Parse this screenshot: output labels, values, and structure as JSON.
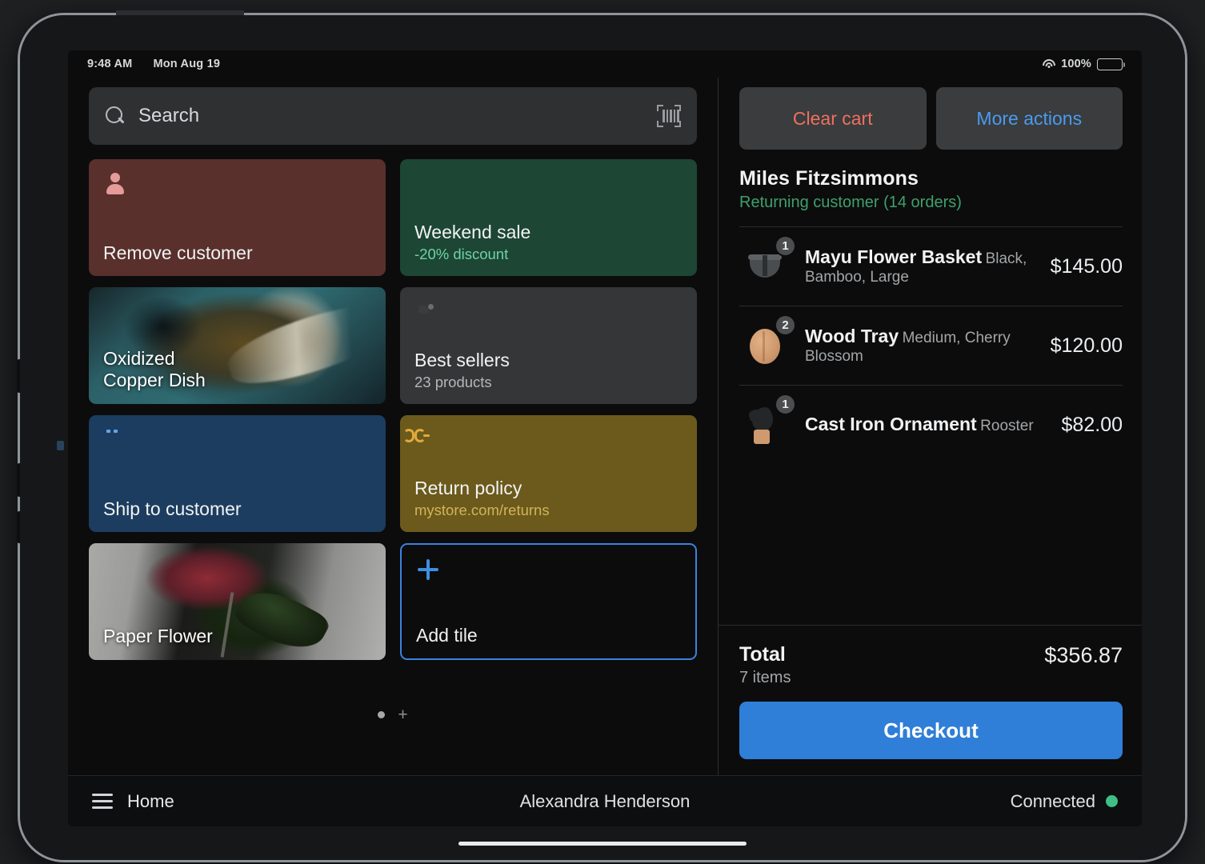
{
  "status_bar": {
    "time": "9:48 AM",
    "date": "Mon Aug 19",
    "wifi_icon": "wifi-icon",
    "battery_percent": "100%",
    "battery_icon": "battery-icon"
  },
  "search": {
    "placeholder": "Search",
    "search_icon": "search-icon",
    "scan_icon": "barcode-scanner-icon"
  },
  "tiles": [
    {
      "id": "remove-customer",
      "title": "Remove customer",
      "subtitle": "",
      "icon": "person-icon",
      "color": "#59302c"
    },
    {
      "id": "weekend-sale",
      "title": "Weekend sale",
      "subtitle": "-20% discount",
      "icon": "discount-badge-icon",
      "color": "#1d4634"
    },
    {
      "id": "oxidized-copper-dish",
      "title": "Oxidized\nCopper Dish",
      "title_line1": "Oxidized",
      "title_line2": "Copper Dish",
      "subtitle": "",
      "icon": "product-photo",
      "color": "#2c6067"
    },
    {
      "id": "best-sellers",
      "title": "Best sellers",
      "subtitle": "23 products",
      "icon": "product-collection-icon",
      "color": "#343638"
    },
    {
      "id": "ship-to-customer",
      "title": "Ship to customer",
      "subtitle": "",
      "icon": "shipping-box-icon",
      "color": "#1c3d5f"
    },
    {
      "id": "return-policy",
      "title": "Return policy",
      "subtitle": "mystore.com/returns",
      "icon": "link-icon",
      "color": "#6b5a1c"
    },
    {
      "id": "paper-flower",
      "title": "Paper Flower",
      "subtitle": "",
      "icon": "product-photo",
      "color": "#8e8e8c"
    },
    {
      "id": "add-tile",
      "title": "Add tile",
      "subtitle": "",
      "icon": "plus-icon",
      "color": "#3b82e0"
    }
  ],
  "page_indicator": {
    "dot": "page-dot",
    "add_page": "+"
  },
  "cart": {
    "clear_label": "Clear cart",
    "clear_color": "#f0705e",
    "more_actions_label": "More actions",
    "more_actions_color": "#4a9bf0",
    "customer_name": "Miles Fitzsimmons",
    "customer_status": "Returning customer (14 orders)",
    "customer_status_color": "#3fa06b",
    "items": [
      {
        "name": "Mayu Flower Basket",
        "variant": "Black, Bamboo, Large",
        "price": "$145.00",
        "qty": "1",
        "thumb": "flower-basket-thumb"
      },
      {
        "name": "Wood Tray",
        "variant": "Medium, Cherry Blossom",
        "price": "$120.00",
        "qty": "2",
        "thumb": "wood-tray-thumb"
      },
      {
        "name": "Cast Iron Ornament",
        "variant": "Rooster",
        "price": "$82.00",
        "qty": "1",
        "thumb": "rooster-ornament-thumb"
      }
    ],
    "total_label": "Total",
    "total_items": "7 items",
    "total_amount": "$356.87",
    "checkout_label": "Checkout",
    "checkout_color": "#2f7ed8"
  },
  "bottom_bar": {
    "menu_icon": "hamburger-menu-icon",
    "home_label": "Home",
    "staff_name": "Alexandra Henderson",
    "connection_label": "Connected",
    "connection_color": "#3fbf86"
  }
}
